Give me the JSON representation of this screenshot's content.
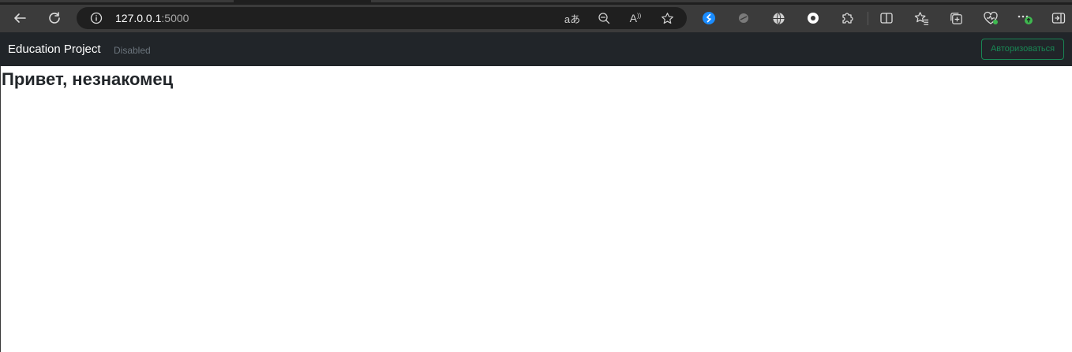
{
  "browser": {
    "url_host": "127.0.0.1",
    "url_port": ":5000",
    "toolbar_icons": [
      "back-icon",
      "refresh-icon",
      "site-info-icon",
      "translate-icon",
      "zoom-out-icon",
      "read-aloud-icon",
      "favorite-star-icon",
      "shazam-extension-icon",
      "extension-icon",
      "globe-extension-icon",
      "record-extension-icon",
      "extensions-puzzle-icon",
      "split-screen-icon",
      "favorites-icon",
      "collections-icon",
      "browser-essentials-icon",
      "more-menu-icon",
      "sidebar-toggle-icon"
    ],
    "colors": {
      "toolbar": "#3b3b3b",
      "omnibox": "#1f1f1f",
      "shazam": "#1a8cff",
      "update_badge": "#3fb950"
    }
  },
  "navbar": {
    "brand": "Education Project",
    "disabled_link": "Disabled",
    "login_button": "Авторизоваться",
    "colors": {
      "background": "#212529",
      "button": "#198754"
    }
  },
  "main": {
    "greeting": "Привет, незнакомец"
  }
}
